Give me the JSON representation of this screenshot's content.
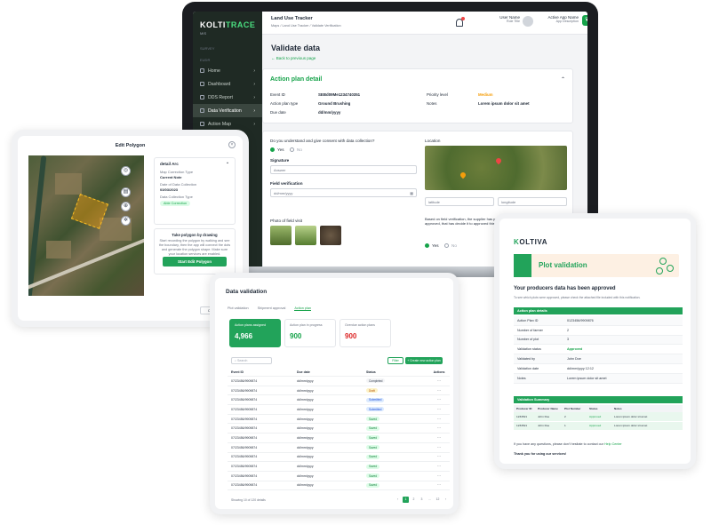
{
  "laptop": {
    "sidebar": {
      "logo": "KOLTI",
      "logo_accent": "TRACE",
      "logo_sub": "MIS",
      "survey": "SURVEY",
      "eudr": "EUDR",
      "items": [
        {
          "label": "Home"
        },
        {
          "label": "Dashboard"
        },
        {
          "label": "DDS Report"
        },
        {
          "label": "Data Verification"
        },
        {
          "label": "Action Map"
        }
      ]
    },
    "topbar": {
      "title": "Land Use Tracker",
      "breadcrumb": "Maps / Land Use Tracker / Validate Verification",
      "user_name": "User Name",
      "user_role": "Role Title",
      "app_name": "Active App Name",
      "app_desc": "App Description"
    },
    "page": {
      "title": "Validate data",
      "back": "Back to previous page",
      "action_plan_title": "Action plan detail",
      "fields": {
        "event_id_label": "Event ID",
        "event_id": "SEBd09Me1234740351",
        "priority_label": "Priority level",
        "priority": "Medium",
        "plan_type_label": "Action plan type",
        "plan_type": "Ground Brushing",
        "notes_label": "Notes",
        "notes": "Lorem ipsum dolor sit amet",
        "due_label": "Due date",
        "due": "dd/mm/yyyy"
      },
      "consent_q": "Do you understand and give consent with data collection?",
      "yes": "Yes",
      "no": "No",
      "signature_label": "Signature",
      "signature_value": "Answer",
      "field_verif_label": "Field verification",
      "field_verif_value": "dd/mm/yyyy",
      "location_label": "Location",
      "lat": "latitude",
      "lng": "longitude",
      "photo_label": "Photo of field visit",
      "based_text": "Based on field verification, the supplier has provided information submitted collected and approved, that has decide it to approved this farm as free from Deforestation risk"
    }
  },
  "edit_polygon": {
    "title": "Edit Polygon",
    "detail_title": "detail Arc",
    "map_conv_label": "Map Correction Type",
    "map_conv_value": "Current Note",
    "date_label": "Date of Data Collection",
    "date_value": "03/03/2023",
    "type_label": "Data Collection Type",
    "type_tag": "Able Correction",
    "poly_title": "Take polygon by drawing",
    "poly_desc": "Start recording the polygon by walking and see the boundary, then the app will connect the dots and generate the polygon shape. Make sure your location services are enabled.",
    "start_btn": "Start Edit Polygon",
    "close_btn": "Close"
  },
  "data_validation": {
    "title": "Data validation",
    "tabs": [
      "Plot validation",
      "Shipment approval",
      "Action plan"
    ],
    "stats": [
      {
        "label": "Action plans assigned",
        "value": "4,966"
      },
      {
        "label": "Action plan in progress",
        "value": "900"
      },
      {
        "label": "Overdue action plans",
        "value": "900"
      }
    ],
    "search_placeholder": "Search",
    "filter_label": "Filter",
    "new_plan_label": "+ Create new action plan",
    "columns": [
      "Event ID",
      "Due date",
      "Status",
      "Actions"
    ],
    "rows": [
      {
        "id": "07/23456/9909874",
        "due": "dd/mm/yyyy",
        "status": "Completed",
        "cls": "p-completed"
      },
      {
        "id": "07/23456/9909874",
        "due": "dd/mm/yyyy",
        "status": "Draft",
        "cls": "p-draft"
      },
      {
        "id": "07/23456/9909874",
        "due": "dd/mm/yyyy",
        "status": "Submitted",
        "cls": "p-submitted"
      },
      {
        "id": "07/23456/9909874",
        "due": "dd/mm/yyyy",
        "status": "Submitted",
        "cls": "p-submitted"
      },
      {
        "id": "07/23456/9909874",
        "due": "dd/mm/yyyy",
        "status": "Saved",
        "cls": "p-saved"
      },
      {
        "id": "07/23456/9909874",
        "due": "dd/mm/yyyy",
        "status": "Saved",
        "cls": "p-saved"
      },
      {
        "id": "07/23456/9909874",
        "due": "dd/mm/yyyy",
        "status": "Saved",
        "cls": "p-saved"
      },
      {
        "id": "07/23456/9909874",
        "due": "dd/mm/yyyy",
        "status": "Saved",
        "cls": "p-saved"
      },
      {
        "id": "07/23456/9909874",
        "due": "dd/mm/yyyy",
        "status": "Saved",
        "cls": "p-saved"
      },
      {
        "id": "07/23456/9909874",
        "due": "dd/mm/yyyy",
        "status": "Saved",
        "cls": "p-saved"
      },
      {
        "id": "07/23456/9909874",
        "due": "dd/mm/yyyy",
        "status": "Saved",
        "cls": "p-saved"
      },
      {
        "id": "07/23456/9909874",
        "due": "dd/mm/yyyy",
        "status": "Saved",
        "cls": "p-saved"
      }
    ],
    "showing": "Showing 10 of 120 details",
    "pages": [
      "‹",
      "1",
      "2",
      "3",
      "...",
      "12",
      "›"
    ]
  },
  "plot_email": {
    "logo": "K",
    "logo_accent": "OLTIVA",
    "banner_title": "Plot validation",
    "heading": "Your producers data has been approved",
    "sub": "To see which plots were approved, please check the attached file included with this notification.",
    "section1": "Action plan details",
    "details": [
      {
        "k": "Action Plan ID",
        "v": "0123456/9909876"
      },
      {
        "k": "Number of farmer",
        "v": "2"
      },
      {
        "k": "Number of plot",
        "v": "3"
      },
      {
        "k": "Validation status",
        "v": "Approved"
      },
      {
        "k": "Validated by",
        "v": "John Doe"
      },
      {
        "k": "Validation date",
        "v": "dd/mm/yyyy 12:12"
      },
      {
        "k": "Notes",
        "v": "Lorem ipsum dolor sit amet"
      }
    ],
    "section2": "Validation Summary",
    "summary_cols": [
      "Producer ID",
      "Producer Name",
      "Plot Number",
      "Status",
      "Notes"
    ],
    "summary_rows": [
      {
        "a": "1234521",
        "b": "John Doe",
        "c": "2",
        "d": "Approved",
        "e": "Lorem ipsum dolor sit amet"
      },
      {
        "a": "1234521",
        "b": "John Doe",
        "c": "1",
        "d": "Approved",
        "e": "Lorem ipsum dolor sit amet"
      }
    ],
    "foot1": "If you have any questions, please don't hesitate to contact our",
    "foot1_link": "Help Center",
    "foot2": "Thank you for using our services!"
  },
  "colors": {
    "brand_green": "#22a35a",
    "warning": "#f59e0b",
    "danger": "#dc2626"
  }
}
